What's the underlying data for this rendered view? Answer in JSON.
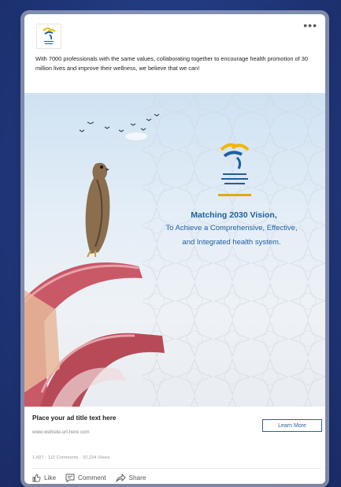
{
  "post": {
    "more_label": "•••",
    "text": "With 7000 professionals with the same values, collaborating together to encourage health promotion of 30 million lives and improve their wellness, we believe that we can!"
  },
  "creative": {
    "headline": "Matching 2030 Vision,",
    "line1": "To Achieve a Comprehensive, Effective,",
    "line2": "and Integrated health system.",
    "brand_colors": {
      "gold": "#f2b705",
      "blue": "#1f5fa0",
      "arch": "#b84a58"
    }
  },
  "ad": {
    "title": "Place your ad title text here",
    "url": "www.website-url-here.com",
    "cta_label": "Learn More"
  },
  "stats": "1,607 · 112 Comments · 32,234 Views",
  "actions": {
    "like": "Like",
    "comment": "Comment",
    "share": "Share"
  }
}
